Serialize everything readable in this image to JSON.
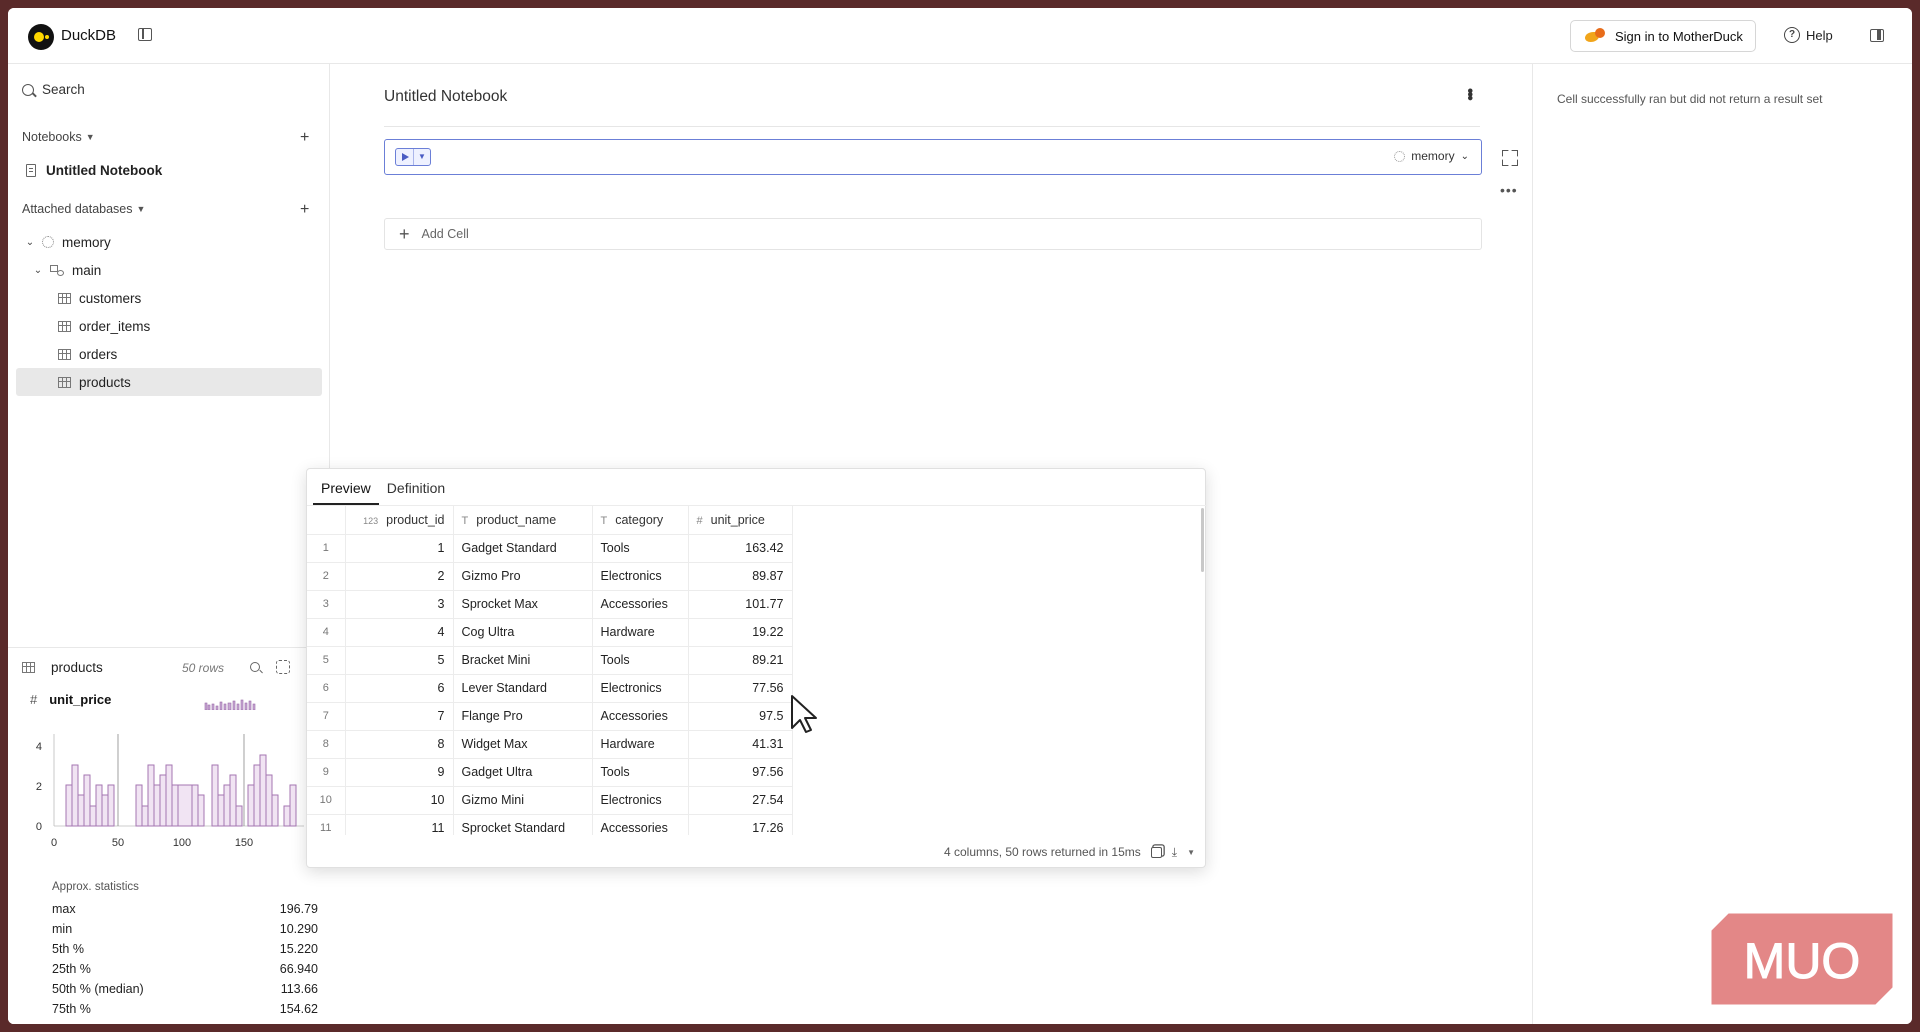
{
  "app": {
    "brand": "DuckDB",
    "signin_label": "Sign in to MotherDuck",
    "help_label": "Help"
  },
  "sidebar": {
    "search_label": "Search",
    "notebooks_label": "Notebooks",
    "notebooks": [
      {
        "name": "Untitled Notebook"
      }
    ],
    "attached_label": "Attached databases",
    "database": "memory",
    "schema": "main",
    "tables": [
      "customers",
      "order_items",
      "orders",
      "products"
    ],
    "selected_table": "products"
  },
  "column_panel": {
    "table": "products",
    "rows_label": "50 rows",
    "column": "unit_price",
    "histogram": {
      "y_ticks": [
        "0",
        "2",
        "4"
      ],
      "x_ticks": [
        "0",
        "50",
        "100",
        "150"
      ]
    },
    "stats_title": "Approx. statistics",
    "stats": [
      {
        "label": "max",
        "value": "196.79"
      },
      {
        "label": "min",
        "value": "10.290"
      },
      {
        "label": "5th %",
        "value": "15.220"
      },
      {
        "label": "25th %",
        "value": "66.940"
      },
      {
        "label": "50th % (median)",
        "value": "113.66"
      },
      {
        "label": "75th %",
        "value": "154.62"
      }
    ]
  },
  "notebook": {
    "title": "Untitled Notebook",
    "cell_db": "memory",
    "add_cell_label": "Add Cell"
  },
  "right_panel": {
    "message": "Cell successfully ran but did not return a result set"
  },
  "preview": {
    "tabs": [
      "Preview",
      "Definition"
    ],
    "active_tab": "Preview",
    "columns": [
      {
        "name": "product_id",
        "type_glyph": "123"
      },
      {
        "name": "product_name",
        "type_glyph": "T"
      },
      {
        "name": "category",
        "type_glyph": "T"
      },
      {
        "name": "unit_price",
        "type_glyph": "#"
      }
    ],
    "rows": [
      [
        "1",
        "1",
        "Gadget Standard",
        "Tools",
        "163.42"
      ],
      [
        "2",
        "2",
        "Gizmo Pro",
        "Electronics",
        "89.87"
      ],
      [
        "3",
        "3",
        "Sprocket Max",
        "Accessories",
        "101.77"
      ],
      [
        "4",
        "4",
        "Cog Ultra",
        "Hardware",
        "19.22"
      ],
      [
        "5",
        "5",
        "Bracket Mini",
        "Tools",
        "89.21"
      ],
      [
        "6",
        "6",
        "Lever Standard",
        "Electronics",
        "77.56"
      ],
      [
        "7",
        "7",
        "Flange Pro",
        "Accessories",
        "97.5"
      ],
      [
        "8",
        "8",
        "Widget Max",
        "Hardware",
        "41.31"
      ],
      [
        "9",
        "9",
        "Gadget Ultra",
        "Tools",
        "97.56"
      ],
      [
        "10",
        "10",
        "Gizmo Mini",
        "Electronics",
        "27.54"
      ],
      [
        "11",
        "11",
        "Sprocket Standard",
        "Accessories",
        "17.26"
      ]
    ],
    "footer": "4 columns, 50 rows returned in 15ms"
  },
  "watermark": {
    "text": "MUO",
    "color": "#e07070"
  }
}
